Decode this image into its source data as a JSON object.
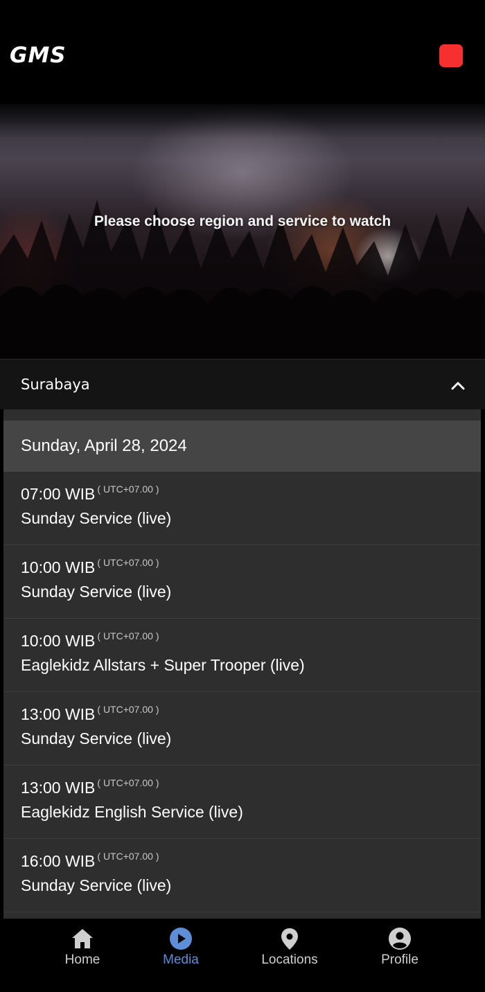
{
  "header": {
    "logo": "GMS",
    "record_icon": "record-icon",
    "record_color": "#f5302e"
  },
  "hero": {
    "message": "Please choose region and service to watch"
  },
  "region": {
    "name": "Surabaya",
    "expand_icon": "chevron-up-icon"
  },
  "schedule": {
    "date": "Sunday, April 28, 2024",
    "services": [
      {
        "time": "07:00 WIB",
        "tz": "( UTC+07.00 )",
        "title": "Sunday Service (live)"
      },
      {
        "time": "10:00 WIB",
        "tz": "( UTC+07.00 )",
        "title": "Sunday Service (live)"
      },
      {
        "time": "10:00 WIB",
        "tz": "( UTC+07.00 )",
        "title": "Eaglekidz Allstars + Super Trooper (live)"
      },
      {
        "time": "13:00 WIB",
        "tz": "( UTC+07.00 )",
        "title": "Sunday Service (live)"
      },
      {
        "time": "13:00 WIB",
        "tz": "( UTC+07.00 )",
        "title": "Eaglekidz English Service (live)"
      },
      {
        "time": "16:00 WIB",
        "tz": "( UTC+07.00 )",
        "title": "Sunday Service (live)"
      }
    ]
  },
  "nav": {
    "active_color": "#5f8ed8",
    "items": [
      {
        "label": "Home",
        "icon": "home-icon"
      },
      {
        "label": "Media",
        "icon": "play-circle-icon"
      },
      {
        "label": "Locations",
        "icon": "map-pin-icon"
      },
      {
        "label": "Profile",
        "icon": "user-circle-icon"
      }
    ]
  }
}
